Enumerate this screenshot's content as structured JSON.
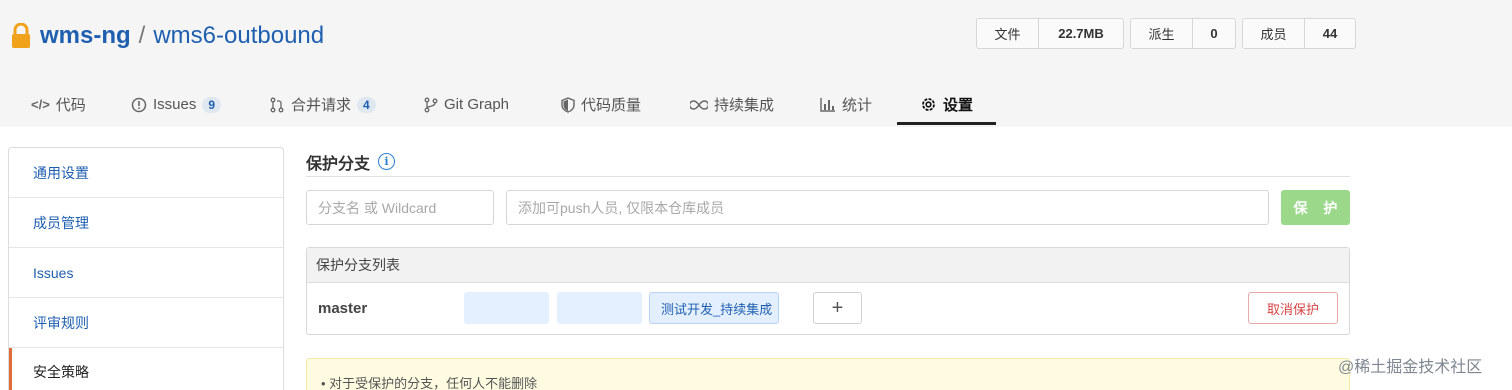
{
  "repo": {
    "owner": "wms-ng",
    "separator": "/",
    "name": "wms6-outbound"
  },
  "stats": [
    {
      "label": "文件",
      "value": "22.7MB"
    },
    {
      "label": "派生",
      "value": "0"
    },
    {
      "label": "成员",
      "value": "44"
    }
  ],
  "tabs": [
    {
      "icon": "</>",
      "label": "代码",
      "badge": ""
    },
    {
      "icon": "!",
      "label": "Issues",
      "badge": "9"
    },
    {
      "icon": "merge",
      "label": "合并请求",
      "badge": "4"
    },
    {
      "icon": "branch",
      "label": "Git Graph",
      "badge": ""
    },
    {
      "icon": "shield",
      "label": "代码质量",
      "badge": ""
    },
    {
      "icon": "infinity",
      "label": "持续集成",
      "badge": ""
    },
    {
      "icon": "bars",
      "label": "统计",
      "badge": ""
    },
    {
      "icon": "gear",
      "label": "设置",
      "badge": ""
    }
  ],
  "sidebar": {
    "items": [
      {
        "label": "通用设置"
      },
      {
        "label": "成员管理"
      },
      {
        "label": "Issues"
      },
      {
        "label": "评审规则"
      },
      {
        "label": "安全策略"
      }
    ]
  },
  "protect": {
    "title": "保护分支",
    "branch_placeholder": "分支名 或 Wildcard",
    "member_placeholder": "添加可push人员, 仅限本仓库成员",
    "button_label": "保 护",
    "list_title": "保护分支列表",
    "rows": [
      {
        "branch": "master",
        "member_tag": "测试开发_持续集成",
        "remove_label": "×",
        "add_label": "+",
        "cancel_label": "取消保护"
      }
    ],
    "note": "• 对于受保护的分支，任何人不能删除"
  },
  "watermark": "@稀土掘金技术社区",
  "colors": {
    "link": "#1f5fb0",
    "protect_button": "#9bd889",
    "danger": "#d64545",
    "active_tab_underline": "#222222"
  }
}
